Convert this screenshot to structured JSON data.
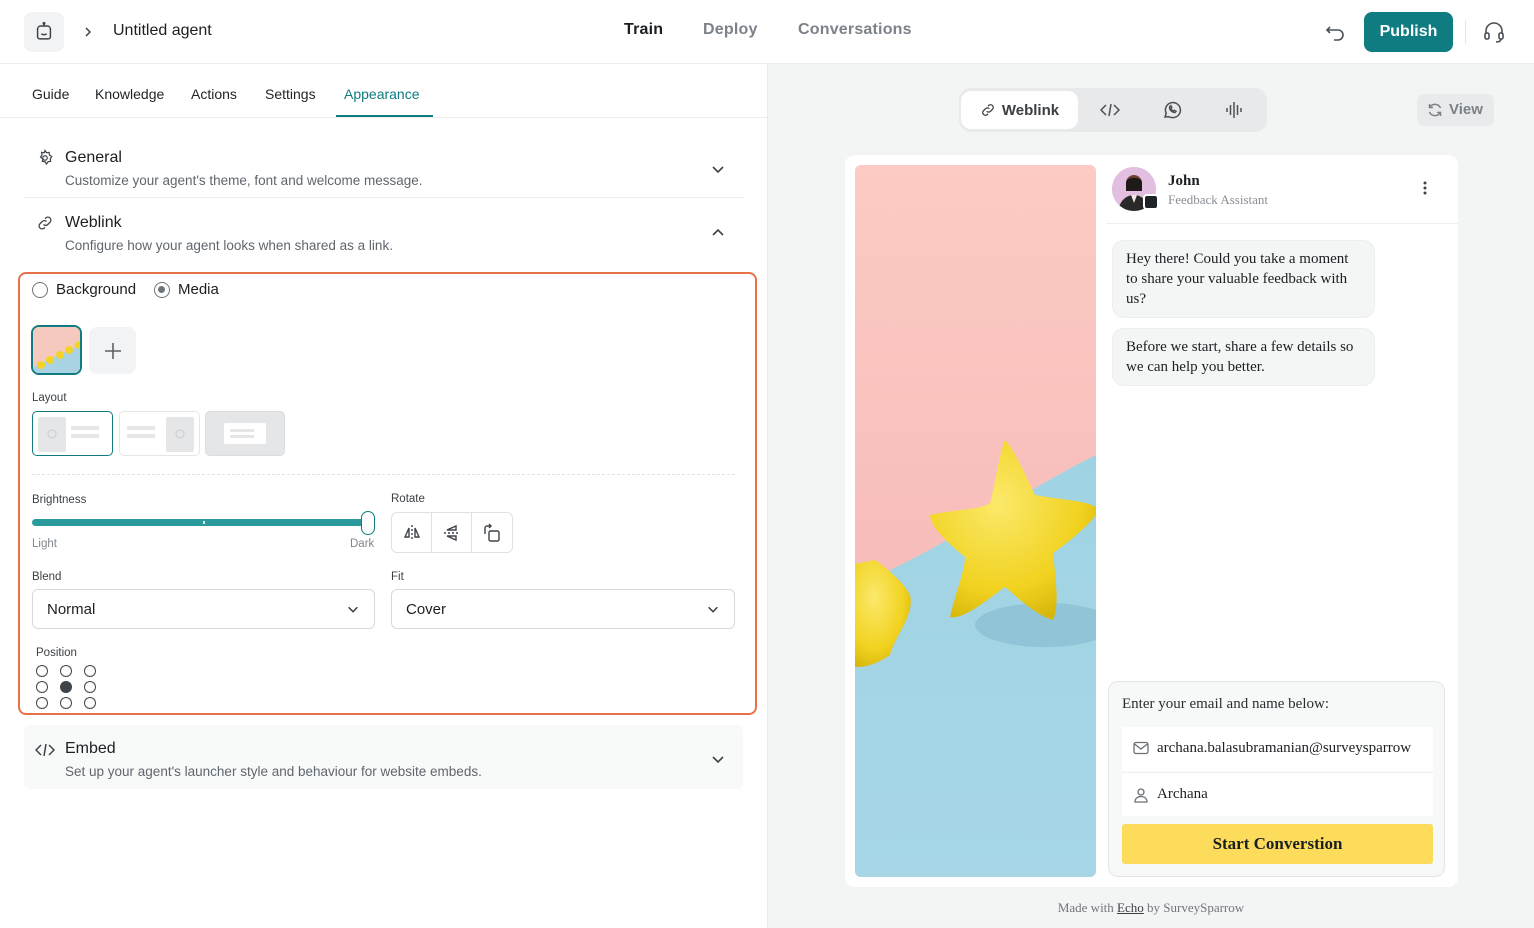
{
  "header": {
    "agent_name": "Untitled agent",
    "tabs": [
      "Train",
      "Deploy",
      "Conversations"
    ],
    "active_tab": "Train",
    "publish_label": "Publish"
  },
  "left": {
    "sub_tabs": [
      "Guide",
      "Knowledge",
      "Actions",
      "Settings",
      "Appearance"
    ],
    "active_sub_tab": "Appearance",
    "general": {
      "title": "General",
      "desc": "Customize your agent's theme, font and welcome message."
    },
    "weblink": {
      "title": "Weblink",
      "desc": "Configure how your agent looks when shared as a link.",
      "bg_options": [
        "Background",
        "Media"
      ],
      "selected_bg_option": "Media",
      "layout_label": "Layout",
      "layout_selected_index": 0,
      "brightness_label": "Brightness",
      "brightness_level": 1.0,
      "brightness_min_label": "Light",
      "brightness_max_label": "Dark",
      "rotate_label": "Rotate",
      "blend_label": "Blend",
      "blend_value": "Normal",
      "fit_label": "Fit",
      "fit_value": "Cover",
      "position_label": "Position",
      "position_selected": "center"
    },
    "embed": {
      "title": "Embed",
      "desc": "Set up your agent's launcher style and behaviour for website embeds."
    }
  },
  "preview": {
    "channels": [
      "Weblink"
    ],
    "view_label": "View",
    "agent_name": "John",
    "agent_role": "Feedback Assistant",
    "messages": [
      "Hey there! Could you take a moment to share your valuable feedback with us?",
      "Before we start, share a few details so we can help you better."
    ],
    "form_title": "Enter your email and name below:",
    "email_value": "archana.balasubramanian@surveysparrow",
    "name_value": "Archana",
    "start_button": "Start Converstion",
    "footer_prefix": "Made with ",
    "footer_brand": "Echo",
    "footer_suffix": " by SurveySparrow"
  },
  "colors": {
    "accent": "#0e7c80",
    "highlight_border": "#e9714a",
    "start_button": "#fddc5c"
  }
}
